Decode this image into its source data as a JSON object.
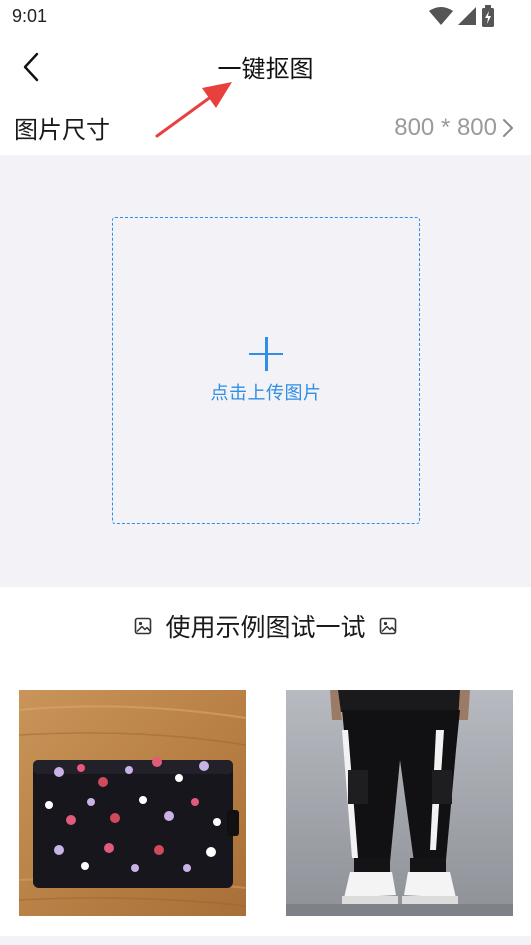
{
  "status_bar": {
    "time": "9:01",
    "icons": [
      "wifi-icon",
      "signal-icon",
      "battery-icon"
    ]
  },
  "nav": {
    "back_icon": "chevron-left-icon",
    "title": "一键抠图"
  },
  "size_row": {
    "label": "图片尺寸",
    "value": "800 * 800",
    "chevron_icon": "chevron-right-icon"
  },
  "upload": {
    "label": "点击上传图片",
    "icon": "plus-icon",
    "accent_color": "#2f8ee6"
  },
  "examples": {
    "title": "使用示例图试一试",
    "icon": "image-icon",
    "thumbnails": [
      "floral-wallet-photo",
      "cargo-pants-photo"
    ]
  },
  "annotation": {
    "arrow_color": "#e8403d"
  }
}
